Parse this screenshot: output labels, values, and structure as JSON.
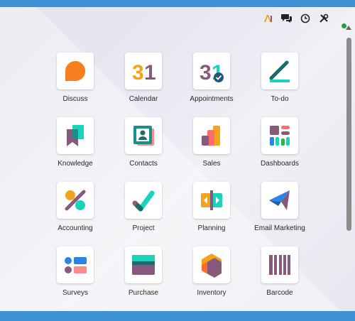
{
  "topbar": {
    "icons": [
      "ai-icon",
      "chat-icon",
      "clock-icon",
      "tools-icon"
    ]
  },
  "apps": [
    {
      "label": "Discuss",
      "icon": "discuss-icon"
    },
    {
      "label": "Calendar",
      "icon": "calendar-icon",
      "glyph": "31"
    },
    {
      "label": "Appointments",
      "icon": "appointments-icon",
      "glyph": "31"
    },
    {
      "label": "To-do",
      "icon": "todo-icon"
    },
    {
      "label": "Knowledge",
      "icon": "knowledge-icon"
    },
    {
      "label": "Contacts",
      "icon": "contacts-icon"
    },
    {
      "label": "Sales",
      "icon": "sales-icon"
    },
    {
      "label": "Dashboards",
      "icon": "dashboards-icon"
    },
    {
      "label": "Accounting",
      "icon": "accounting-icon"
    },
    {
      "label": "Project",
      "icon": "project-icon"
    },
    {
      "label": "Planning",
      "icon": "planning-icon"
    },
    {
      "label": "Email Marketing",
      "icon": "email-marketing-icon"
    },
    {
      "label": "Surveys",
      "icon": "surveys-icon"
    },
    {
      "label": "Purchase",
      "icon": "purchase-icon"
    },
    {
      "label": "Inventory",
      "icon": "inventory-icon"
    },
    {
      "label": "Barcode",
      "icon": "barcode-icon"
    }
  ],
  "colors": {
    "purple": "#875a7b",
    "teal": "#1ad3bb",
    "orange": "#f29c1f",
    "red": "#fc6c6c",
    "blue": "#2c82e6",
    "green": "#2fb344"
  }
}
